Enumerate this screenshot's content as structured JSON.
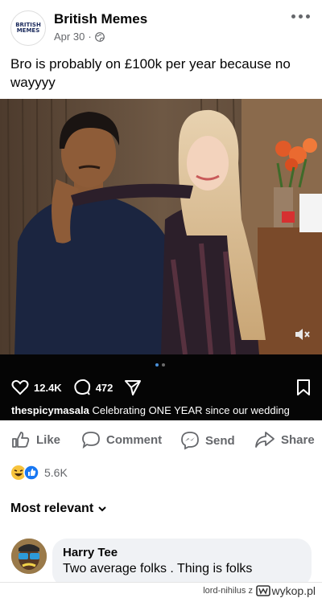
{
  "post": {
    "page_name": "British Memes",
    "logo_text_top": "BRITISH",
    "logo_text_bottom": "MEMES",
    "date": "Apr 30",
    "separator": "·",
    "caption": "Bro is probably on £100k per year because no wayyyy",
    "more_icon": "more-horizontal-icon",
    "privacy_icon": "globe-icon"
  },
  "instagram": {
    "likes": "12.4K",
    "comments": "472",
    "username": "thespicymasala",
    "caption": "Celebrating ONE YEAR since our wedding",
    "carousel_active_color": "#4a90d9",
    "carousel_inactive_color": "#6b6b6b"
  },
  "actions": {
    "like": "Like",
    "comment": "Comment",
    "send": "Send",
    "share": "Share"
  },
  "reactions": {
    "count": "5.6K",
    "emojis": [
      "haha-emoji",
      "like-emoji"
    ]
  },
  "comments": {
    "sort_label": "Most relevant",
    "items": [
      {
        "author": "Harry Tee",
        "text": "Two average folks . Thing is folks"
      }
    ]
  },
  "watermark": {
    "user": "lord-nihilus",
    "z": "z",
    "site": "wykop.pl"
  },
  "colors": {
    "accent_blue": "#1877f2",
    "text_secondary": "#65676b",
    "bubble_bg": "#f0f2f5"
  }
}
